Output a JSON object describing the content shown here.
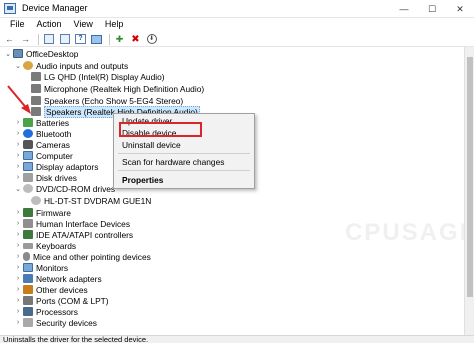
{
  "window": {
    "title": "Device Manager",
    "minimize": "—",
    "maximize": "☐",
    "close": "✕"
  },
  "menu": [
    "File",
    "Action",
    "View",
    "Help"
  ],
  "toolbar": {
    "back": "←",
    "forward": "→",
    "help": "?",
    "enable": "✚",
    "remove": "✖",
    "update": "⬇"
  },
  "tree": {
    "root": "OfficeDesktop",
    "audio": {
      "label": "Audio inputs and outputs",
      "children": [
        "LG QHD (Intel(R) Display Audio)",
        "Microphone (Realtek High Definition Audio)",
        "Speakers (Echo Show 5-EG4 Stereo)",
        "Speakers (Realtek High Definition Audio)"
      ]
    },
    "batteries": "Batteries",
    "bluetooth": "Bluetooth",
    "cameras": "Cameras",
    "computer": "Computer",
    "display": "Display adaptors",
    "disk": "Disk drives",
    "dvd": {
      "label": "DVD/CD-ROM drives",
      "children": [
        "HL-DT-ST DVDRAM GUE1N"
      ]
    },
    "firmware": "Firmware",
    "hid": "Human Interface Devices",
    "ide": "IDE ATA/ATAPI controllers",
    "keyboards": "Keyboards",
    "mice": "Mice and other pointing devices",
    "monitors": "Monitors",
    "network": "Network adapters",
    "other": "Other devices",
    "ports": "Ports (COM & LPT)",
    "processors": "Processors",
    "security": "Security devices"
  },
  "context_menu": {
    "update": "Update driver",
    "disable": "Disable device",
    "uninstall": "Uninstall device",
    "scan": "Scan for hardware changes",
    "properties": "Properties"
  },
  "watermark": "CPUSAGE",
  "status": "Uninstalls the driver for the selected device.",
  "colors": {
    "selection": "#cce8ff",
    "highlight_box": "#d9262b",
    "arrow": "#d9262b"
  }
}
